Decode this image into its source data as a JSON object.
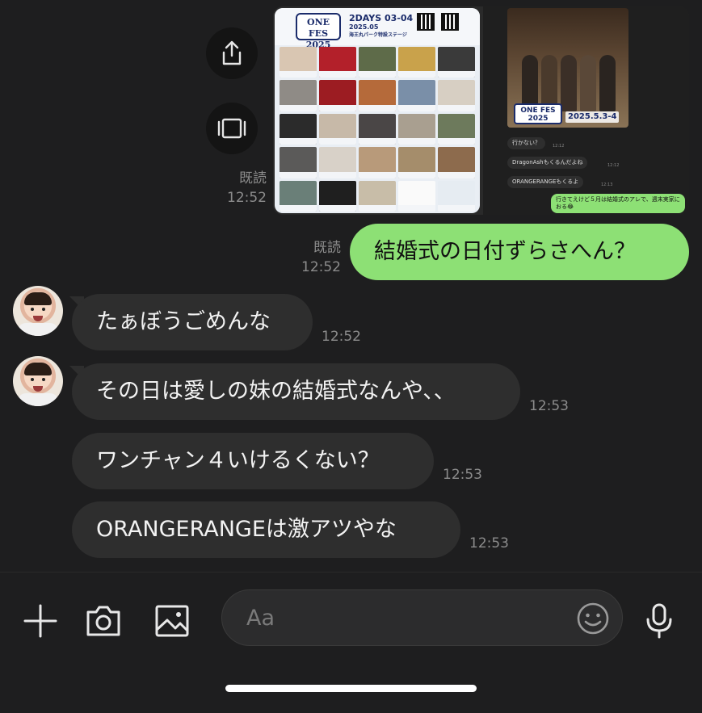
{
  "conversation": {
    "shared_image": {
      "poster": {
        "logo_text": "ONE FES 2025",
        "title_line1": "2DAYS 03-04",
        "title_line2": "2025.05",
        "title_line3": "海王丸パーク特設ステージ"
      },
      "screenshot": {
        "band_logo": "ONE FES 2025",
        "band_date": "2025.5.3-4",
        "messages": [
          {
            "text": "行かない？",
            "time": "12:12"
          },
          {
            "text": "DragonAshもくるんだよね",
            "time": "12:12"
          },
          {
            "text": "ORANGERANGEもくるよ",
            "time": "12:13"
          },
          {
            "text": "行きてえけど５月は結婚式のアレで、週末実家におる😂",
            "time": ""
          }
        ]
      },
      "read_label": "既読",
      "time": "12:52"
    },
    "messages": [
      {
        "sender": "me",
        "text": "結婚式の日付ずらさへん？",
        "read": "既読",
        "time": "12:52"
      },
      {
        "sender": "friend",
        "text": "たぁぼうごめんな",
        "time": "12:52"
      },
      {
        "sender": "friend",
        "text": "その日は愛しの妹の結婚式なんや、、",
        "time": "12:53"
      },
      {
        "sender": "friend",
        "text": "ワンチャン４いけるくない？",
        "time": "12:53"
      },
      {
        "sender": "friend",
        "text": "ORANGERANGEは激アツやな",
        "time": "12:53"
      }
    ]
  },
  "input": {
    "placeholder": "Aa",
    "icons": [
      "plus-icon",
      "camera-icon",
      "image-icon",
      "emoji-icon",
      "microphone-icon"
    ]
  },
  "colors": {
    "background": "#1e1e1f",
    "bubble_out": "#8de075",
    "bubble_in": "#2e2e2e"
  }
}
